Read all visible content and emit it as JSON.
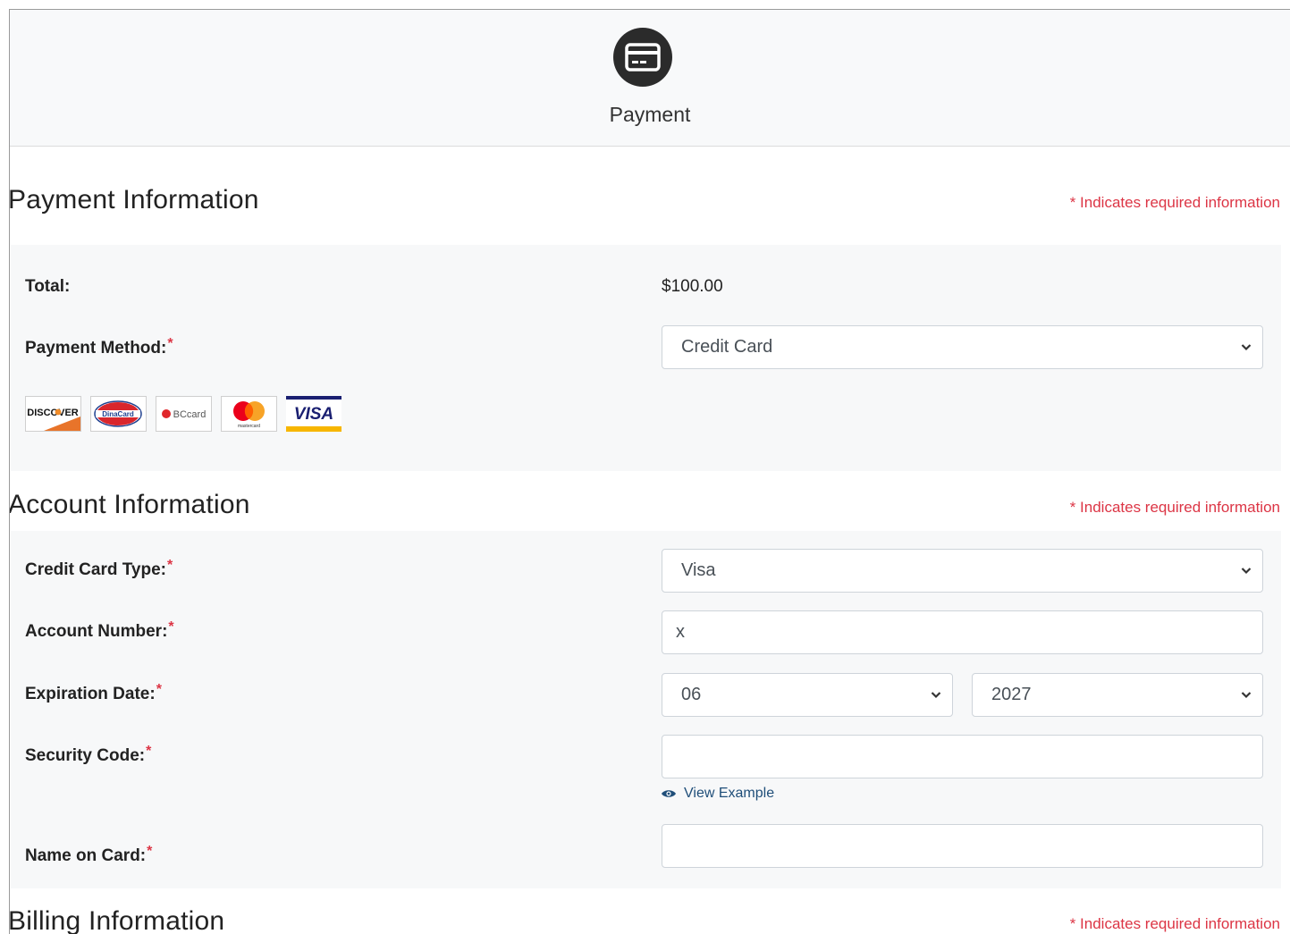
{
  "step": {
    "label": "Payment",
    "icon": "credit-card-icon"
  },
  "required_note": "* Indicates required information",
  "payment_info": {
    "title": "Payment Information",
    "total_label": "Total:",
    "total_value": "$100.00",
    "method_label": "Payment Method:",
    "method_value": "Credit Card",
    "card_logos": [
      "DISCOVER",
      "DinaCard",
      "BCcard",
      "mastercard",
      "VISA"
    ]
  },
  "account_info": {
    "title": "Account Information",
    "card_type_label": "Credit Card Type:",
    "card_type_value": "Visa",
    "account_number_label": "Account Number:",
    "account_number_value": "x",
    "expiration_label": "Expiration Date:",
    "expiration_month": "06",
    "expiration_year": "2027",
    "security_code_label": "Security Code:",
    "security_code_value": "",
    "view_example": "View Example",
    "name_label": "Name on Card:",
    "name_value": ""
  },
  "billing_info": {
    "title": "Billing Information"
  },
  "colors": {
    "required": "#dc3545",
    "link": "#1f4e79",
    "panel": "#f7f8f9",
    "icon_bg": "#2b2b2b"
  }
}
